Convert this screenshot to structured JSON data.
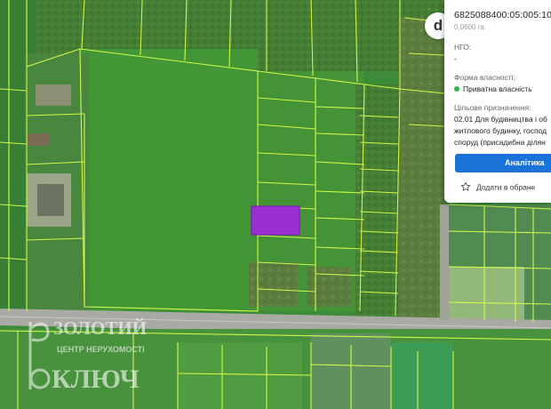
{
  "parcel": {
    "cadastral_number": "6825088400:05:005:10",
    "area": "0,0600 га",
    "ngo_label": "НГО:",
    "ngo_value": "-",
    "ownership_label": "Форма власності:",
    "ownership_value": "Приватна власність",
    "ownership_color": "#2eb34a",
    "purpose_label": "Цільове призначення:",
    "purpose_lines": [
      "02.01 Для будівництва і об",
      "житлового будинку, господ",
      "споруд (присадибна ділян"
    ]
  },
  "actions": {
    "analytics_label": "Аналітика",
    "favorite_label": "Додати в обране",
    "favorite_icon": "star-icon"
  },
  "badge": {
    "letter": "d"
  },
  "watermark": {
    "line1": "ЗОЛОТИЙ",
    "line2": "ЦЕНТР НЕРУХОМОСТІ",
    "line3": "КЛЮЧ"
  },
  "colors": {
    "parcel_fill": "#9b2fd0",
    "parcel_stroke": "#7a1db8",
    "boundary": "#d8ff4a",
    "accent": "#1a73d9"
  }
}
